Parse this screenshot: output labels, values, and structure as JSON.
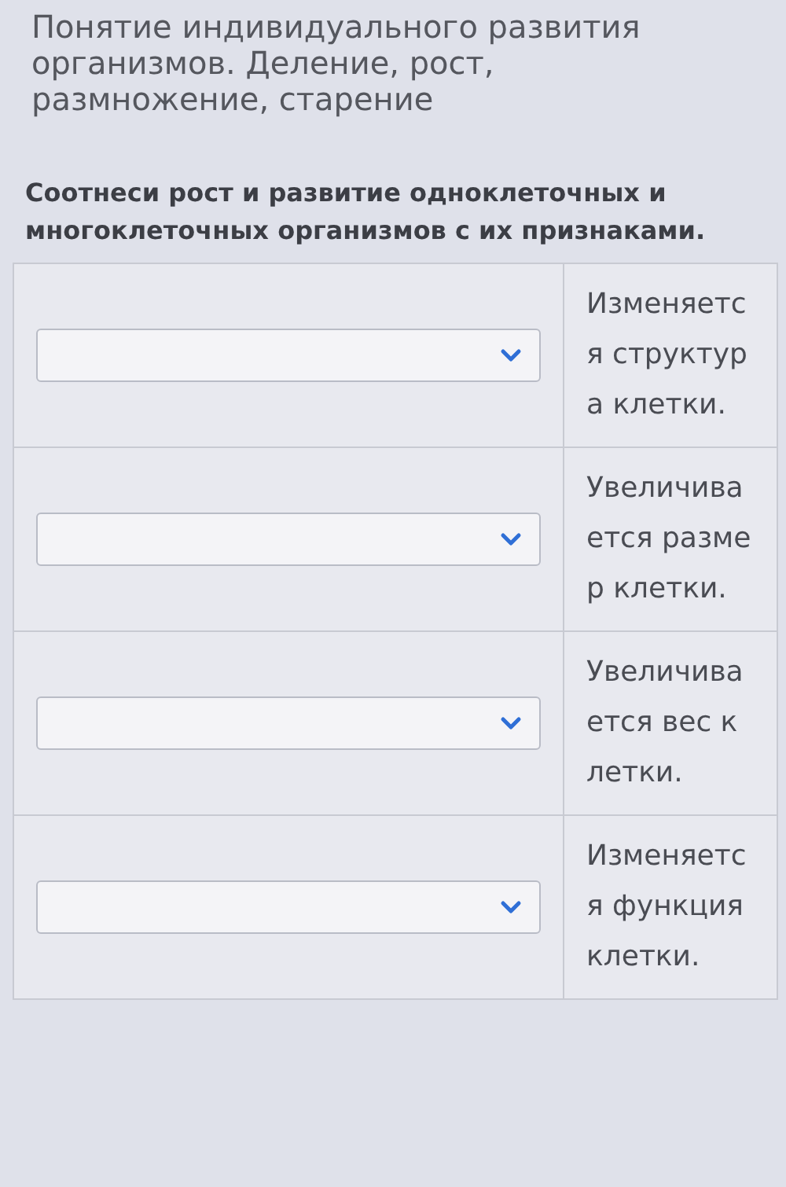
{
  "lesson_title": "Понятие индивидуального развития организмов. Деление, рост, размножение, старение",
  "question": "Соотнеси рост и развитие одноклеточных и многоклеточных организмов с их признаками.",
  "rows": [
    {
      "answer": "Изменяется структура клетки."
    },
    {
      "answer": "Увеличивается размер клетки."
    },
    {
      "answer": "Увеличивается вес клетки."
    },
    {
      "answer": "Изменяется функция клетки."
    }
  ]
}
